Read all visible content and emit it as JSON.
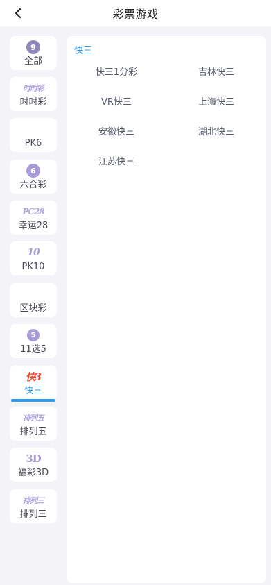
{
  "header": {
    "title": "彩票游戏"
  },
  "sidebar": {
    "items": [
      {
        "label": "全部",
        "icon": "ball-9-icon",
        "badge": "9"
      },
      {
        "label": "时时彩",
        "icon": "shishicai-logo-icon",
        "logo": "时时彩"
      },
      {
        "label": "PK6",
        "icon": ""
      },
      {
        "label": "六合彩",
        "icon": "ball-6-icon",
        "badge": "6"
      },
      {
        "label": "幸运28",
        "icon": "pc28-logo-icon",
        "logo": "PC28"
      },
      {
        "label": "PK10",
        "icon": "pk10-logo-icon",
        "logo": "10"
      },
      {
        "label": "区块彩",
        "icon": ""
      },
      {
        "label": "11选5",
        "icon": "11x5-logo-icon",
        "logo": "5"
      },
      {
        "label": "快三",
        "icon": "kuaisan-logo-icon",
        "logo": "快3",
        "active": true
      },
      {
        "label": "排列五",
        "icon": "pailie-logo-icon",
        "logo": "排列五"
      },
      {
        "label": "福彩3D",
        "icon": "3d-logo-icon",
        "logo": "3D"
      },
      {
        "label": "排列三",
        "icon": "pailie-logo-icon",
        "logo": "排列三"
      }
    ]
  },
  "panel": {
    "title": "快三",
    "games": [
      "快三1分彩",
      "吉林快三",
      "VR快三",
      "上海快三",
      "安徽快三",
      "湖北快三",
      "江苏快三"
    ]
  },
  "colors": {
    "accent": "#2a9df4",
    "icon_purple": "#a99bd7",
    "background": "#f4f4f8"
  }
}
